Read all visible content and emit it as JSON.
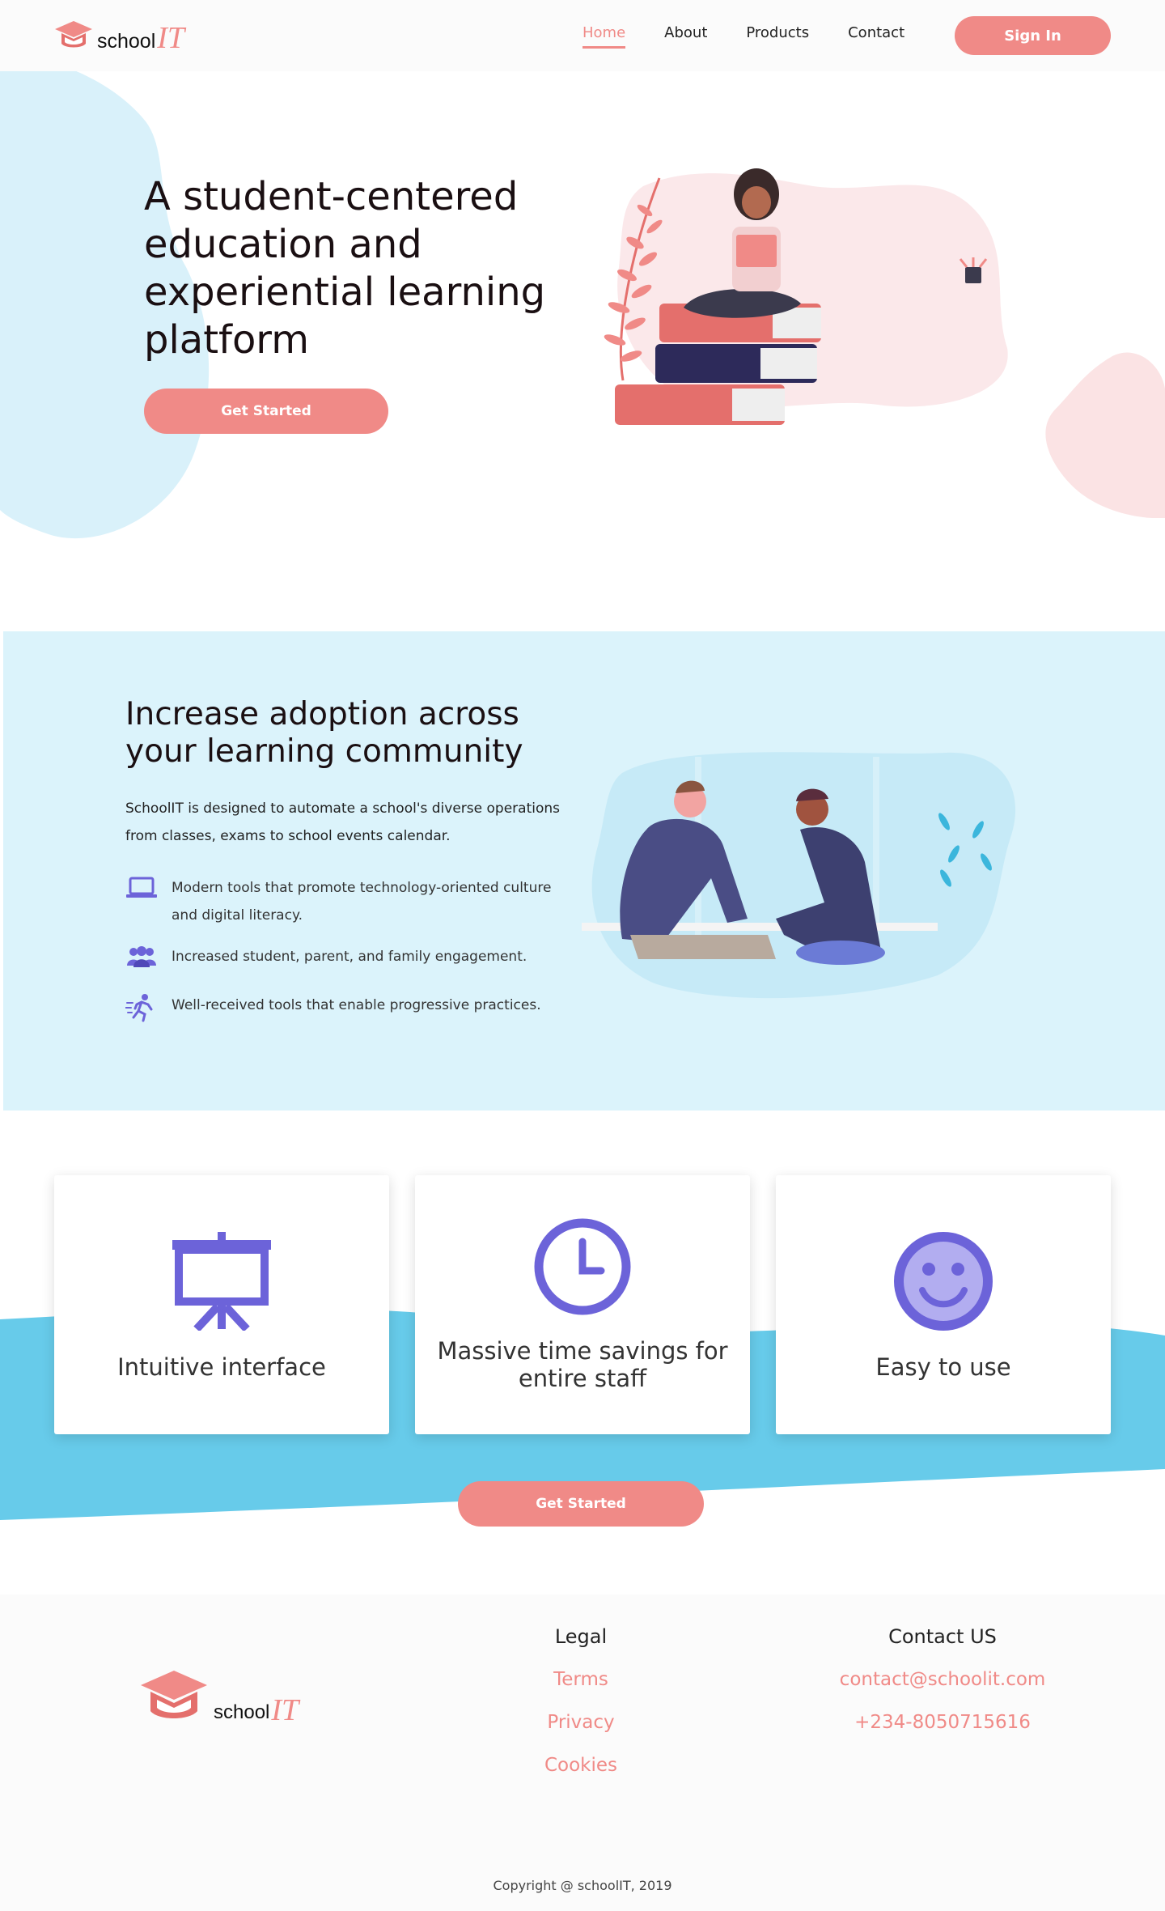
{
  "brand": {
    "name_part1": "school",
    "name_part2": "IT"
  },
  "nav": {
    "items": [
      {
        "label": "Home",
        "active": true
      },
      {
        "label": "About",
        "active": false
      },
      {
        "label": "Products",
        "active": false
      },
      {
        "label": "Contact",
        "active": false
      }
    ],
    "signin_label": "Sign In"
  },
  "hero": {
    "title": "A student-centered education and experiential learning platform",
    "cta_label": "Get Started"
  },
  "adoption": {
    "title": "Increase adoption across your learning community",
    "description": "SchoolIT is designed to automate a school's diverse operations from classes, exams to school events calendar.",
    "bullets": [
      {
        "icon": "laptop-icon",
        "text": "Modern tools that promote technology-oriented culture and digital literacy."
      },
      {
        "icon": "people-group-icon",
        "text": "Increased student, parent, and family engagement."
      },
      {
        "icon": "running-person-icon",
        "text": "Well-received tools that enable progressive practices."
      }
    ]
  },
  "cards": [
    {
      "icon": "presentation-board-icon",
      "label": "Intuitive interface"
    },
    {
      "icon": "clock-icon",
      "label": "Massive time savings for entire staff"
    },
    {
      "icon": "smiley-face-icon",
      "label": "Easy to use"
    }
  ],
  "cta2_label": "Get Started",
  "footer": {
    "legal": {
      "heading": "Legal",
      "links": [
        "Terms",
        "Privacy",
        "Cookies"
      ]
    },
    "contact": {
      "heading": "Contact US",
      "email": "contact@schoolit.com",
      "phone": "+234-8050715616"
    },
    "copyright": "Copyright @  schoolIT, 2019"
  },
  "colors": {
    "accent": "#f08a87",
    "icon_purple": "#6c63d9",
    "feature_bg": "#dbf3fb",
    "wave_blue": "#67cbea",
    "hero_blob": "#d9f1fa",
    "pink_blob": "#fbe3e4"
  }
}
